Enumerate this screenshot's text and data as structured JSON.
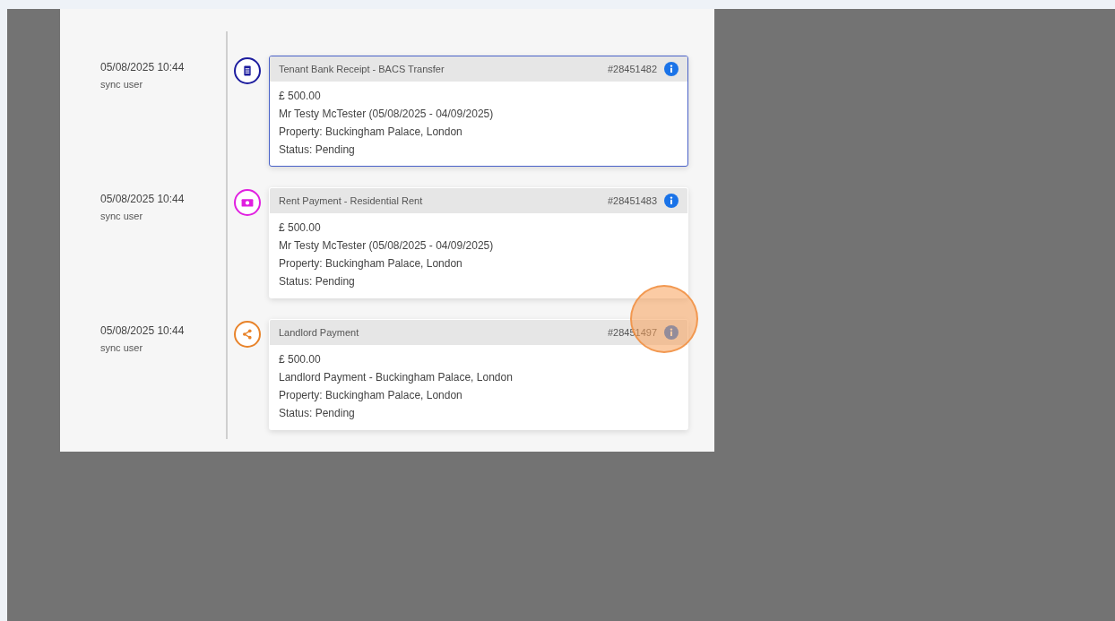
{
  "timeline": {
    "events": [
      {
        "time": "05/08/2025 10:44",
        "user": "sync user",
        "kind": "receipt",
        "color": "#1c1c9e",
        "selected": true,
        "title": "Tenant Bank Receipt - BACS Transfer",
        "ref": "#28451482",
        "lines": [
          "£ 500.00",
          "Mr Testy McTester (05/08/2025 - 04/09/2025)",
          "Property: Buckingham Palace, London",
          "Status: Pending"
        ]
      },
      {
        "time": "05/08/2025 10:44",
        "user": "sync user",
        "kind": "money",
        "color": "#e01fe0",
        "selected": false,
        "title": "Rent Payment - Residential Rent",
        "ref": "#28451483",
        "lines": [
          "£ 500.00",
          "Mr Testy McTester (05/08/2025 - 04/09/2025)",
          "Property: Buckingham Palace, London",
          "Status: Pending"
        ]
      },
      {
        "time": "05/08/2025 10:44",
        "user": "sync user",
        "kind": "share",
        "color": "#e8832a",
        "selected": false,
        "title": "Landlord Payment",
        "ref": "#28451497",
        "lines": [
          "£ 500.00",
          "Landlord Payment - Buckingham Palace, London",
          "Property: Buckingham Palace, London",
          "Status: Pending"
        ]
      }
    ]
  }
}
